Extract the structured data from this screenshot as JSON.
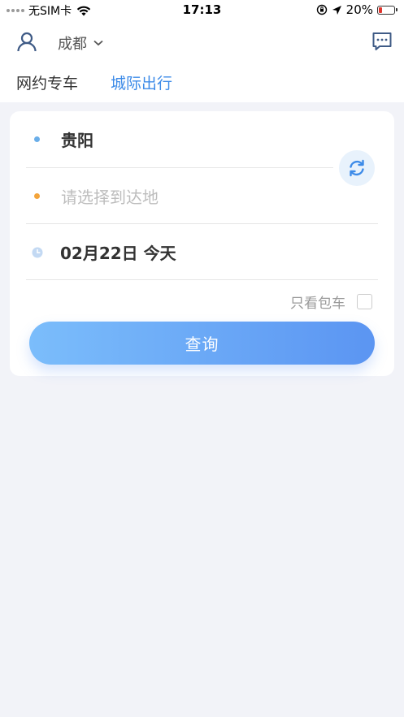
{
  "status_bar": {
    "carrier": "无SIM卡",
    "time": "17:13",
    "battery": "20%",
    "battery_level": 0.2
  },
  "header": {
    "user_icon": "user-icon",
    "city": "成都",
    "message_icon": "message-icon"
  },
  "tabs": [
    {
      "label": "网约专车",
      "active": false
    },
    {
      "label": "城际出行",
      "active": true
    }
  ],
  "form": {
    "from_city": "贵阳",
    "to_placeholder": "请选择到达地",
    "date": "02月22日 今天",
    "charter_only_label": "只看包车",
    "charter_only_checked": false,
    "query_button": "查询"
  },
  "colors": {
    "accent": "#3d8be8",
    "from_dot": "#6aaee9",
    "to_dot": "#f3a43b",
    "button_start": "#7bbdfb",
    "button_end": "#5b95f2",
    "background": "#f2f3f8"
  }
}
